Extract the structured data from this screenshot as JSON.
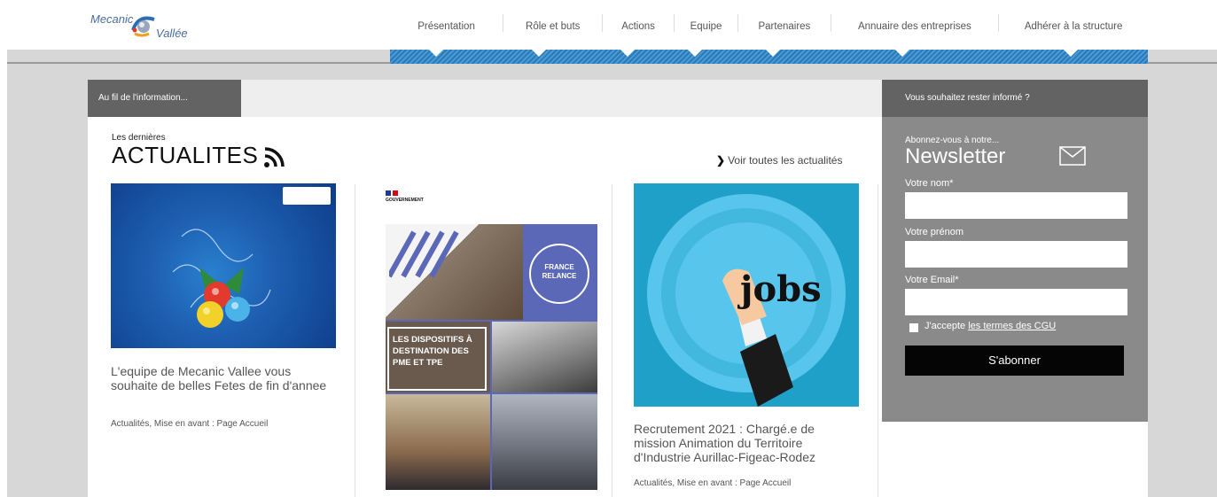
{
  "header": {
    "logo_text_1": "Mecanic",
    "logo_text_2": "Vallée"
  },
  "nav": {
    "items": [
      {
        "label": "Présentation"
      },
      {
        "label": "Rôle et buts"
      },
      {
        "label": "Actions"
      },
      {
        "label": "Equipe"
      },
      {
        "label": "Partenaires"
      },
      {
        "label": "Annuaire des entreprises"
      },
      {
        "label": "Adhérer à la structure"
      }
    ]
  },
  "content": {
    "tab_label": "Au fil de l'information...",
    "kicker": "Les dernières",
    "title": "ACTUALITES",
    "see_all": "Voir toutes les actualités",
    "cards": [
      {
        "title": "L'equipe de Mecanic Vallee vous souhaite de belles Fetes de fin d'annee",
        "meta": "Actualités, Mise en avant : Page Accueil"
      },
      {
        "image_text": "LES DISPOSITIFS À DESTINATION DES PME ET TPE",
        "gov_text": "GOUVERNEMENT",
        "badge_text": "FRANCE RELANCE"
      },
      {
        "image_text": "jobs",
        "title": "Recrutement 2021 : Chargé.e de mission Animation du Territoire d'Industrie Aurillac-Figeac-Rodez",
        "meta": "Actualités, Mise en avant : Page Accueil"
      }
    ]
  },
  "newsletter": {
    "header": "Vous souhaitez rester informé ?",
    "subtitle": "Abonnez-vous à notre...",
    "title": "Newsletter",
    "fields": [
      {
        "label": "Votre nom*"
      },
      {
        "label": "Votre prénom"
      },
      {
        "label": "Votre Email*"
      }
    ],
    "accept_prefix": "J'accepte",
    "accept_link": "les termes des CGU",
    "submit": "S'abonner"
  },
  "colors": {
    "nav_band": "#2b7ab8",
    "dark_tab": "#636363",
    "newsletter_bg": "#8a8a8a",
    "button_bg": "#050505",
    "gutter": "#d7d7d7"
  }
}
